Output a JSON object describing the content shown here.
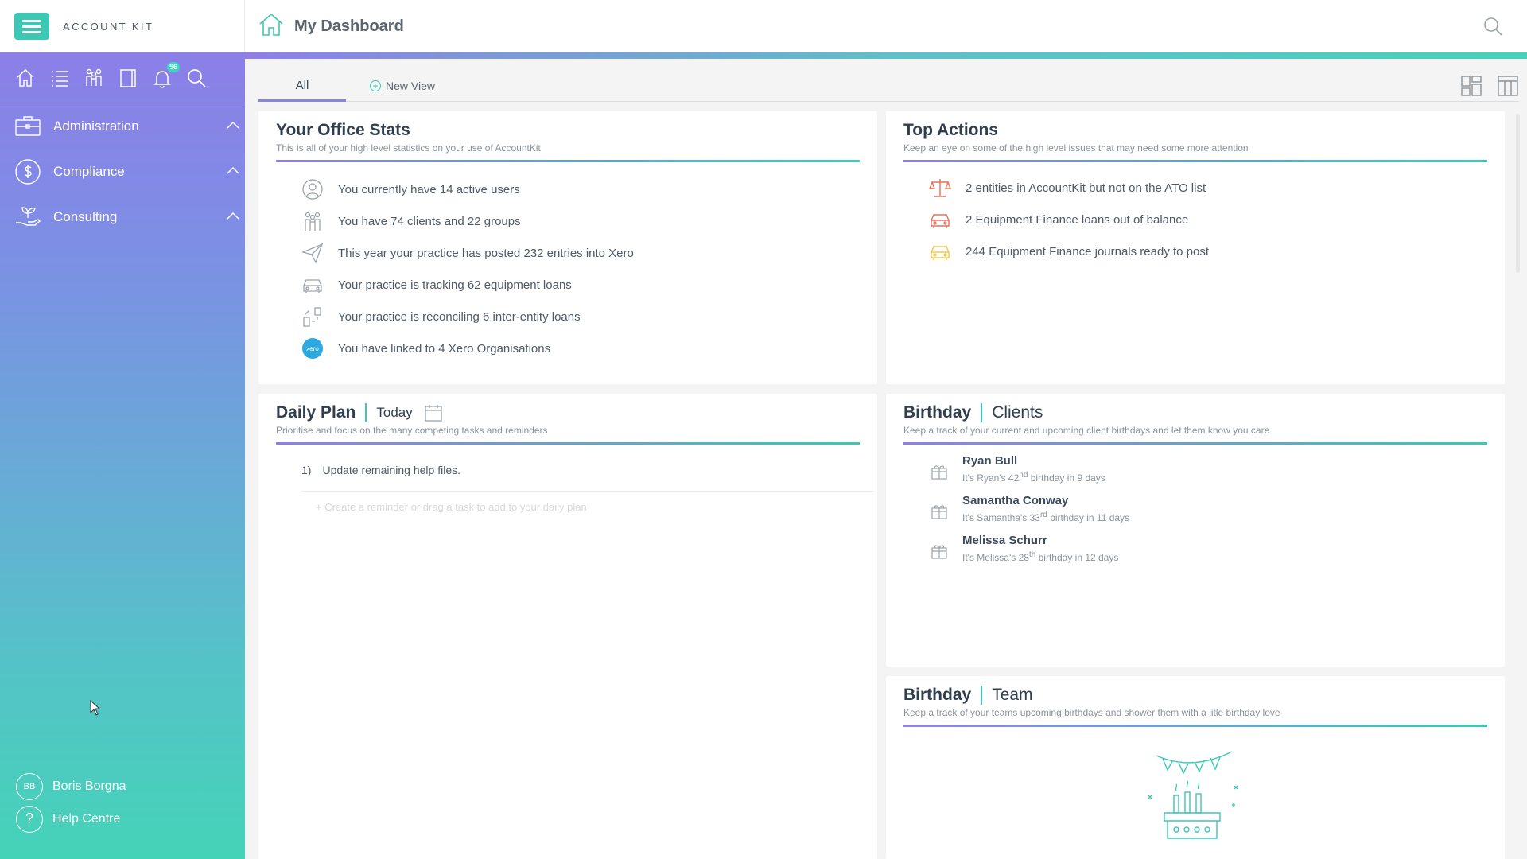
{
  "brand": {
    "name": "ACCOUNT KIT"
  },
  "header": {
    "title": "My Dashboard"
  },
  "sidebar": {
    "notifications_count": "56",
    "items": [
      {
        "label": "Administration",
        "icon": "briefcase-icon"
      },
      {
        "label": "Compliance",
        "icon": "dollar-circle-icon"
      },
      {
        "label": "Consulting",
        "icon": "hand-plant-icon"
      }
    ],
    "user": {
      "initials": "BB",
      "name": "Boris Borgna"
    },
    "help": {
      "label": "Help Centre"
    }
  },
  "tabs": {
    "all": "All",
    "new_view": "New View"
  },
  "office_stats": {
    "title": "Your Office Stats",
    "subtitle": "This is all of your high level statistics on your use of AccountKit",
    "rows": [
      {
        "text": "You currently have 14 active users",
        "icon": "user-circle-icon"
      },
      {
        "text": "You have 74 clients and 22 groups",
        "icon": "people-group-icon"
      },
      {
        "text": "This year your practice has posted 232 entries into Xero",
        "icon": "paper-plane-icon"
      },
      {
        "text": "Your practice is tracking 62 equipment loans",
        "icon": "car-icon"
      },
      {
        "text": "Your practice is reconciling 6 inter-entity loans",
        "icon": "inter-entity-icon"
      },
      {
        "text": "You have linked to 4 Xero Organisations",
        "icon": "xero-logo-icon"
      }
    ]
  },
  "top_actions": {
    "title": "Top Actions",
    "subtitle": "Keep an eye on some of the high level issues that may need some more attention",
    "rows": [
      {
        "text": "2 entities in AccountKit but not on the ATO list",
        "icon": "scales-icon",
        "color": "#e8705a"
      },
      {
        "text": "2  Equipment Finance loans out of balance",
        "icon": "car-icon",
        "color": "#e8705a"
      },
      {
        "text": "244  Equipment Finance journals ready to post",
        "icon": "car-icon",
        "color": "#f2c94c"
      }
    ]
  },
  "daily_plan": {
    "title": "Daily Plan",
    "date_label": "Today",
    "subtitle": "Prioritise and focus on the many competing tasks and reminders",
    "tasks": [
      {
        "num": "1)",
        "text": "Update remaining help files."
      }
    ],
    "add_placeholder": "+ Create a reminder or drag a task to add to your daily plan"
  },
  "birthday_clients": {
    "title": "Birthday",
    "title_suffix": "Clients",
    "subtitle": "Keep a track of your current and upcoming client birthdays and let them know you care",
    "people": [
      {
        "name": "Ryan Bull",
        "pre": "It's Ryan's 42",
        "sup": "nd",
        "post": " birthday in 9 days"
      },
      {
        "name": "Samantha Conway",
        "pre": "It's Samantha's 33",
        "sup": "rd",
        "post": " birthday in 11 days"
      },
      {
        "name": "Melissa Schurr",
        "pre": "It's Melissa's 28",
        "sup": "th",
        "post": " birthday in 12 days"
      }
    ]
  },
  "birthday_team": {
    "title": "Birthday",
    "title_suffix": "Team",
    "subtitle": "Keep a track of your teams upcoming birthdays and shower them with a litle birthday love"
  },
  "colors": {
    "accent": "#3cc8b4",
    "purple": "#8f7fe6",
    "warning": "#e8705a",
    "pending": "#f2c94c"
  }
}
